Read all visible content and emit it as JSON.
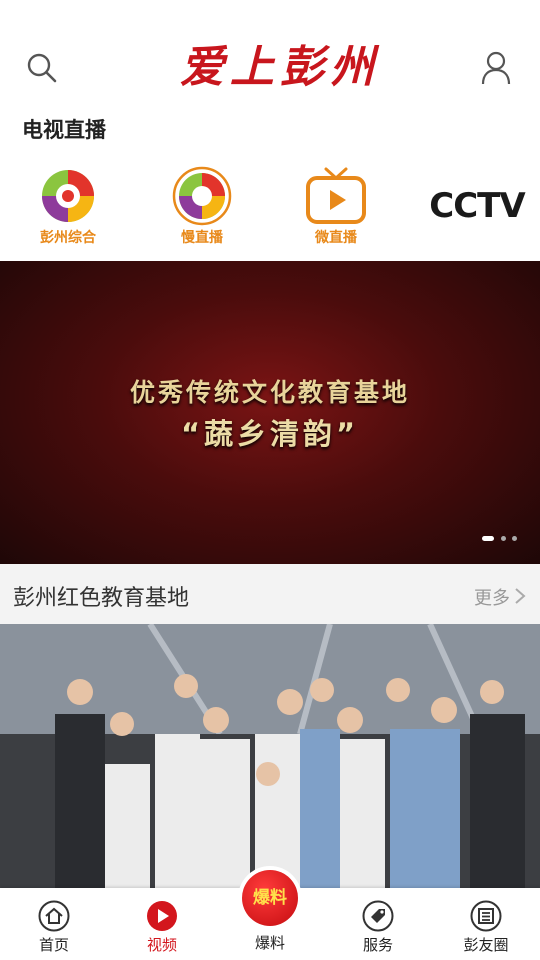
{
  "header": {
    "logo_text": "爱上彭州"
  },
  "live": {
    "section_title": "电视直播",
    "channels": [
      {
        "label": "彭州综合"
      },
      {
        "label": "慢直播"
      },
      {
        "label": "微直播"
      },
      {
        "label": "CCTV"
      }
    ]
  },
  "banner": {
    "line1": "优秀传统文化教育基地",
    "line2": "“蔬乡清韵”",
    "slide_count": 3,
    "active_slide": 1
  },
  "section2": {
    "title": "彭州红色教育基地",
    "more_label": "更多"
  },
  "tabbar": {
    "items": [
      {
        "label": "首页",
        "icon": "home-icon"
      },
      {
        "label": "视频",
        "icon": "play-icon"
      },
      {
        "label": "爆料",
        "icon": "baoliao-icon"
      },
      {
        "label": "服务",
        "icon": "tag-icon"
      },
      {
        "label": "彭友圈",
        "icon": "news-icon"
      }
    ],
    "center_badge": "爆料",
    "active_index": 1
  },
  "colors": {
    "brand_red": "#c8161d",
    "active_tab": "#d3161d",
    "channel_orange": "#e8891a"
  }
}
